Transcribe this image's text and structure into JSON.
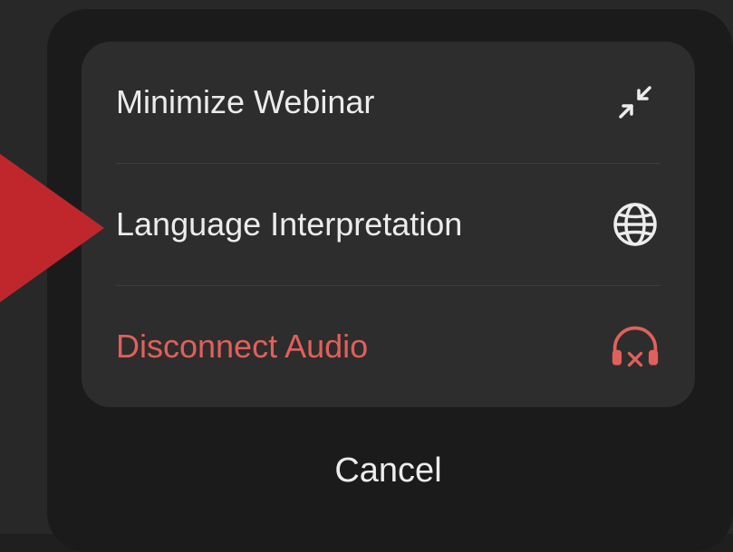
{
  "menu": {
    "items": [
      {
        "label": "Minimize Webinar",
        "icon": "minimize-arrows-icon",
        "danger": false
      },
      {
        "label": "Language Interpretation",
        "icon": "globe-icon",
        "danger": false
      },
      {
        "label": "Disconnect Audio",
        "icon": "headphones-disconnect-icon",
        "danger": true
      }
    ],
    "cancel_label": "Cancel"
  },
  "colors": {
    "text": "#ececec",
    "danger": "#e1605b",
    "pointer": "#c0272d",
    "group_bg": "#2d2d2d",
    "sheet_bg": "#1b1b1b"
  }
}
